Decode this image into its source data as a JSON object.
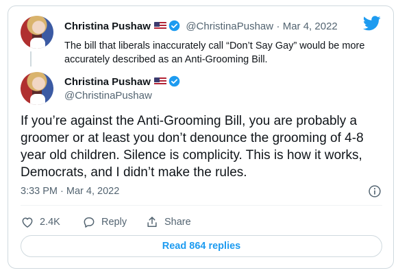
{
  "colors": {
    "accent": "#1d9bf0",
    "text_primary": "#0f1419",
    "text_secondary": "#536471",
    "border": "#cfd9de"
  },
  "quoted_tweet": {
    "display_name": "Christina Pushaw",
    "handle": "@ChristinaPushaw",
    "date": "· Mar 4, 2022",
    "text": "The bill that liberals inaccurately call “Don’t Say Gay” would be more accurately described as an Anti-Grooming Bill."
  },
  "main_tweet": {
    "display_name": "Christina Pushaw",
    "handle": "@ChristinaPushaw",
    "text": "If you’re against the Anti-Grooming Bill, you are probably a groomer or at least you don’t denounce the grooming of 4-8 year old children. Silence is complicity. This is how it works, Democrats, and I didn’t make the rules.",
    "timestamp": "3:33 PM · Mar 4, 2022"
  },
  "actions": {
    "like_count": "2.4K",
    "reply_label": "Reply",
    "share_label": "Share"
  },
  "read_replies_label": "Read 864 replies",
  "icons": [
    "twitter-bird-icon",
    "us-flag-icon",
    "verified-badge-icon",
    "info-icon",
    "heart-icon",
    "reply-bubble-icon",
    "share-icon"
  ]
}
